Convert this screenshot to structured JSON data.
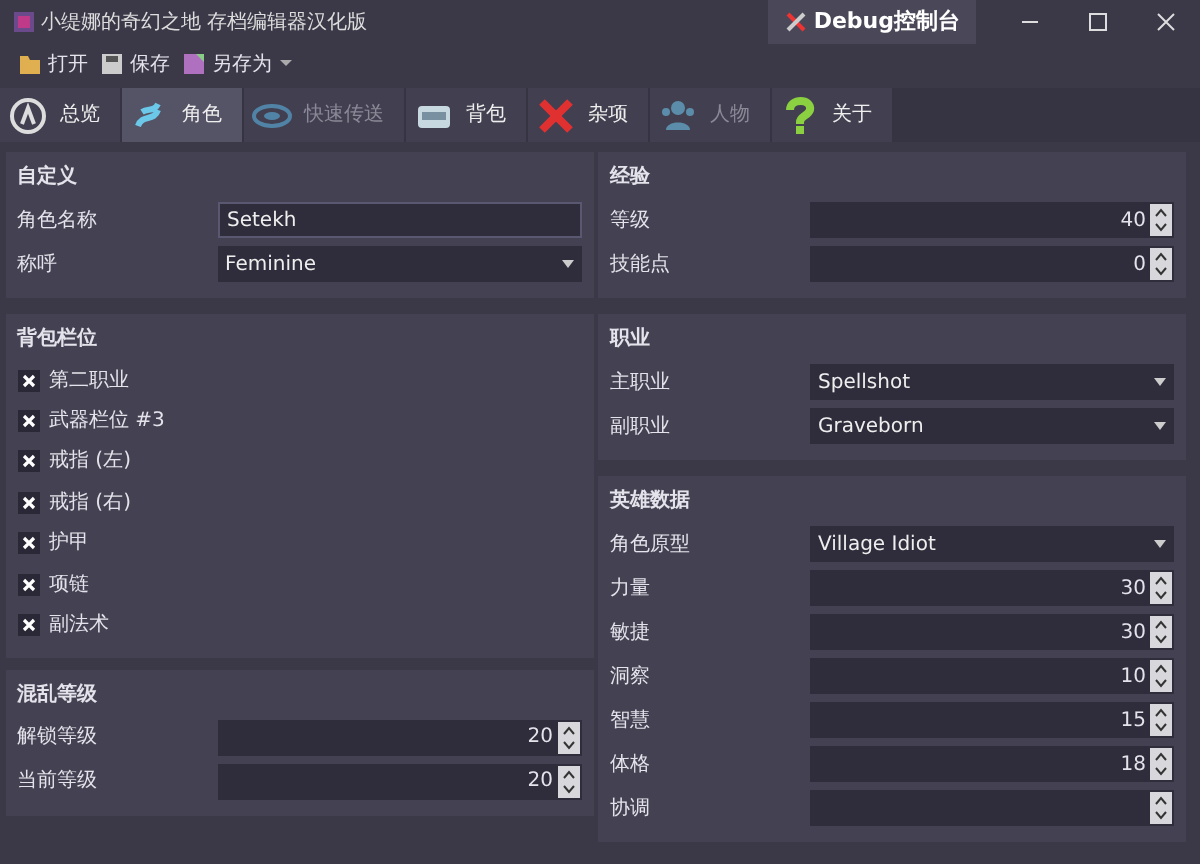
{
  "window": {
    "title": "小缇娜的奇幻之地 存档编辑器汉化版",
    "debug_button": "Debug控制台"
  },
  "toolbar": [
    {
      "label": "打开"
    },
    {
      "label": "保存"
    },
    {
      "label": "另存为"
    }
  ],
  "tabs": [
    {
      "label": "总览",
      "selected": false,
      "disabled": false
    },
    {
      "label": "角色",
      "selected": true,
      "disabled": false
    },
    {
      "label": "快速传送",
      "selected": false,
      "disabled": true
    },
    {
      "label": "背包",
      "selected": false,
      "disabled": false
    },
    {
      "label": "杂项",
      "selected": false,
      "disabled": false
    },
    {
      "label": "人物",
      "selected": false,
      "disabled": true
    },
    {
      "label": "关于",
      "selected": false,
      "disabled": false
    }
  ],
  "columns": [
    [
      {
        "title": "自定义",
        "rows": [
          {
            "kind": "text",
            "label": "角色名称",
            "value": "Setekh"
          },
          {
            "kind": "select",
            "label": "称呼",
            "value": "Feminine"
          }
        ]
      },
      {
        "title": "背包栏位",
        "rows": [
          {
            "kind": "check",
            "label": "第二职业",
            "checked": true
          },
          {
            "kind": "check",
            "label": "武器栏位 #3",
            "checked": true
          },
          {
            "kind": "check",
            "label": "戒指 (左)",
            "checked": true
          },
          {
            "kind": "check",
            "label": "戒指 (右)",
            "checked": true
          },
          {
            "kind": "check",
            "label": "护甲",
            "checked": true
          },
          {
            "kind": "check",
            "label": "项链",
            "checked": true
          },
          {
            "kind": "check",
            "label": "副法术",
            "checked": true
          }
        ]
      },
      {
        "title": "混乱等级",
        "rows": [
          {
            "kind": "spin",
            "label": "解锁等级",
            "value": "20"
          },
          {
            "kind": "spin",
            "label": "当前等级",
            "value": "20"
          }
        ]
      }
    ],
    [
      {
        "title": "经验",
        "rows": [
          {
            "kind": "spin",
            "label": "等级",
            "value": "40"
          },
          {
            "kind": "spin",
            "label": "技能点",
            "value": "0"
          }
        ]
      },
      {
        "title": "职业",
        "rows": [
          {
            "kind": "select",
            "label": "主职业",
            "value": "Spellshot"
          },
          {
            "kind": "select",
            "label": "副职业",
            "value": "Graveborn"
          }
        ]
      },
      {
        "title": "英雄数据",
        "rows": [
          {
            "kind": "select",
            "label": "角色原型",
            "value": "Village Idiot"
          },
          {
            "kind": "spin",
            "label": "力量",
            "value": "30"
          },
          {
            "kind": "spin",
            "label": "敏捷",
            "value": "30"
          },
          {
            "kind": "spin",
            "label": "洞察",
            "value": "10"
          },
          {
            "kind": "spin",
            "label": "智慧",
            "value": "15"
          },
          {
            "kind": "spin",
            "label": "体格",
            "value": "18"
          },
          {
            "kind": "spin",
            "label": "协调"
          }
        ]
      }
    ]
  ]
}
